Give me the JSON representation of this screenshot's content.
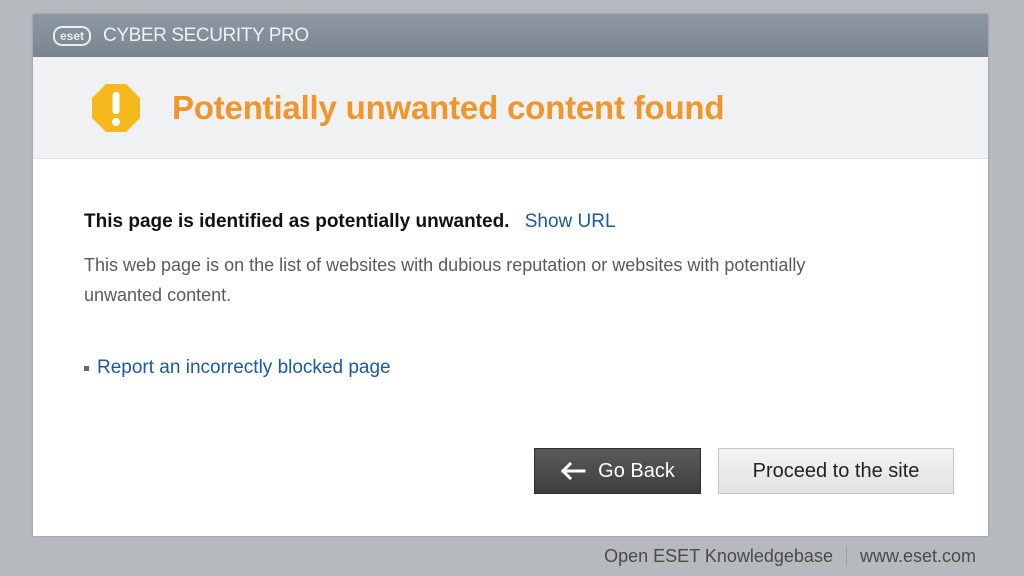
{
  "titlebar": {
    "logo": "eset",
    "product": "CYBER SECURITY PRO"
  },
  "banner": {
    "icon": "warning-octagon-icon",
    "headline": "Potentially unwanted content found",
    "headline_color": "#f0962a",
    "icon_color": "#f5b81d"
  },
  "content": {
    "identified_text": "This page is identified as potentially unwanted.",
    "show_url_label": "Show URL",
    "description": "This web page is on the list of websites with dubious reputation or websites with potentially unwanted content.",
    "report_link": "Report an incorrectly blocked page",
    "link_color": "#1b5aa0"
  },
  "buttons": {
    "go_back_label": "Go Back",
    "proceed_label": "Proceed to the site"
  },
  "footer": {
    "knowledgebase_label": "Open ESET Knowledgebase",
    "site_label": "www.eset.com"
  }
}
